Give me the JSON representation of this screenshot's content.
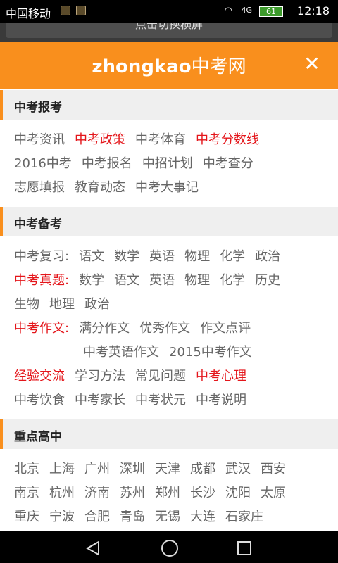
{
  "status_bar": {
    "carrier": "中国移动",
    "network": "4G",
    "battery": "61",
    "time": "12:18"
  },
  "peek": {
    "text": "点击切换横屏"
  },
  "header": {
    "logo_latin": "zhongkao",
    "logo_cn": "中考网",
    "close_glyph": "✕"
  },
  "sections": {
    "baokao": {
      "title": "中考报考",
      "rows": [
        [
          {
            "t": "中考资讯",
            "red": false
          },
          {
            "t": "中考政策",
            "red": true
          },
          {
            "t": "中考体育",
            "red": false
          },
          {
            "t": "中考分数线",
            "red": true
          }
        ],
        [
          {
            "t": "2016中考",
            "red": false
          },
          {
            "t": "中考报名",
            "red": false
          },
          {
            "t": "中招计划",
            "red": false
          },
          {
            "t": "中考查分",
            "red": false
          }
        ],
        [
          {
            "t": "志愿填报",
            "red": false
          },
          {
            "t": "教育动态",
            "red": false
          },
          {
            "t": "中考大事记",
            "red": false
          }
        ]
      ]
    },
    "beikao": {
      "title": "中考备考",
      "rows": [
        [
          {
            "t": "中考复习:",
            "red": false
          },
          {
            "t": "语文",
            "red": false
          },
          {
            "t": "数学",
            "red": false
          },
          {
            "t": "英语",
            "red": false
          },
          {
            "t": "物理",
            "red": false
          },
          {
            "t": "化学",
            "red": false
          },
          {
            "t": "政治",
            "red": false
          }
        ],
        [
          {
            "t": "中考真题:",
            "red": true
          },
          {
            "t": "数学",
            "red": false
          },
          {
            "t": "语文",
            "red": false
          },
          {
            "t": "英语",
            "red": false
          },
          {
            "t": "物理",
            "red": false
          },
          {
            "t": "化学",
            "red": false
          },
          {
            "t": "历史",
            "red": false
          }
        ],
        [
          {
            "t": "生物",
            "red": false
          },
          {
            "t": "地理",
            "red": false
          },
          {
            "t": "政治",
            "red": false
          }
        ],
        [
          {
            "t": "中考作文:",
            "red": true
          },
          {
            "t": "满分作文",
            "red": false
          },
          {
            "t": "优秀作文",
            "red": false
          },
          {
            "t": "作文点评",
            "red": false
          }
        ],
        [
          {
            "t": "中考英语作文",
            "red": false
          },
          {
            "t": "2015中考作文",
            "red": false
          }
        ],
        [
          {
            "t": "经验交流",
            "red": true
          },
          {
            "t": "学习方法",
            "red": false
          },
          {
            "t": "常见问题",
            "red": false
          },
          {
            "t": "中考心理",
            "red": true
          }
        ],
        [
          {
            "t": "中考饮食",
            "red": false
          },
          {
            "t": "中考家长",
            "red": false
          },
          {
            "t": "中考状元",
            "red": false
          },
          {
            "t": "中考说明",
            "red": false
          }
        ]
      ]
    },
    "gaozhong": {
      "title": "重点高中",
      "rows": [
        [
          {
            "t": "北京"
          },
          {
            "t": "上海"
          },
          {
            "t": "广州"
          },
          {
            "t": "深圳"
          },
          {
            "t": "天津"
          },
          {
            "t": "成都"
          },
          {
            "t": "武汉"
          },
          {
            "t": "西安"
          }
        ],
        [
          {
            "t": "南京"
          },
          {
            "t": "杭州"
          },
          {
            "t": "济南"
          },
          {
            "t": "苏州"
          },
          {
            "t": "郑州"
          },
          {
            "t": "长沙"
          },
          {
            "t": "沈阳"
          },
          {
            "t": "太原"
          }
        ],
        [
          {
            "t": "重庆"
          },
          {
            "t": "宁波"
          },
          {
            "t": "合肥"
          },
          {
            "t": "青岛"
          },
          {
            "t": "无锡"
          },
          {
            "t": "大连"
          },
          {
            "t": "石家庄"
          }
        ]
      ]
    }
  },
  "nav": {
    "back": "◁",
    "home": "○",
    "recent": "□"
  }
}
